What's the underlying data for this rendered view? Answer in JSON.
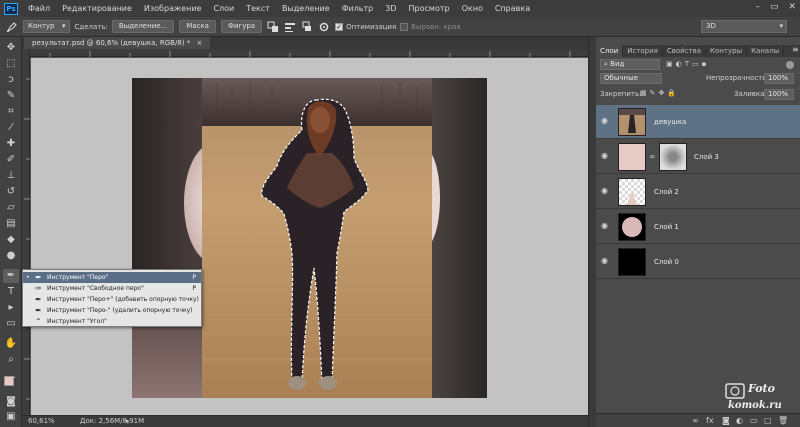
{
  "app": {
    "logo": "Ps",
    "menu": [
      "Файл",
      "Редактирование",
      "Изображение",
      "Слои",
      "Текст",
      "Выделение",
      "Фильтр",
      "3D",
      "Просмотр",
      "Окно",
      "Справка"
    ],
    "window_controls": [
      "–",
      "▭",
      "✕"
    ]
  },
  "options_bar": {
    "tool_icon": "pen-icon",
    "mode_select": "Контур",
    "make_label": "Сделать:",
    "selection_button": "Выделение...",
    "mask_button": "Маска",
    "shape_button": "Фигура",
    "optimization_label": "Оптимизация",
    "optimization_checked": true,
    "align_edges_label": "Выровн. края",
    "align_edges_checked": false,
    "workspace_select": "3D"
  },
  "document": {
    "tab_title": "результат.psd @ 60,6% (девушка, RGB/8) *",
    "tab_close": "×",
    "zoom": "60,61%",
    "doc_size": "Док: 2,56M/8,91M"
  },
  "flyout": {
    "items": [
      {
        "label": "Инструмент \"Перо\"",
        "key": "P",
        "active": true,
        "icon": "pen-icon"
      },
      {
        "label": "Инструмент \"Свободное перо\"",
        "key": "P",
        "active": false,
        "icon": "freeform-pen-icon"
      },
      {
        "label": "Инструмент \"Перо+\" (добавить опорную точку)",
        "key": "",
        "active": false,
        "icon": "add-anchor-icon"
      },
      {
        "label": "Инструмент \"Перо-\" (удалить опорную точку)",
        "key": "",
        "active": false,
        "icon": "delete-anchor-icon"
      },
      {
        "label": "Инструмент \"Угол\"",
        "key": "",
        "active": false,
        "icon": "convert-point-icon"
      }
    ],
    "bullet": "•"
  },
  "layers_panel": {
    "tabs": [
      "Слои",
      "История",
      "Свойства",
      "Контуры",
      "Каналы"
    ],
    "active_tab": "Слои",
    "filter_select": "Вид",
    "blend_mode": "Обычные",
    "opacity_label": "Непрозрачность:",
    "opacity_value": "100%",
    "lock_label": "Закрепить:",
    "fill_label": "Заливка:",
    "fill_value": "100%",
    "layers": [
      {
        "name": "девушка",
        "selected": true,
        "visible": true,
        "has_mask": false,
        "thumb": "photo"
      },
      {
        "name": "Слой 3",
        "selected": false,
        "visible": true,
        "has_mask": true,
        "thumb": "pink"
      },
      {
        "name": "Слой 2",
        "selected": false,
        "visible": true,
        "has_mask": false,
        "thumb": "transparent"
      },
      {
        "name": "Слой 1",
        "selected": false,
        "visible": true,
        "has_mask": false,
        "thumb": "circle"
      },
      {
        "name": "Слой 0",
        "selected": false,
        "visible": true,
        "has_mask": false,
        "thumb": "black"
      }
    ]
  },
  "watermark": {
    "line1": "Foto",
    "line2": "komok.ru"
  },
  "colors": {
    "accent_selected_row": "#5e7185",
    "flyout_active": "#5a6f86",
    "canvas_bg": "#c3c3c3"
  }
}
